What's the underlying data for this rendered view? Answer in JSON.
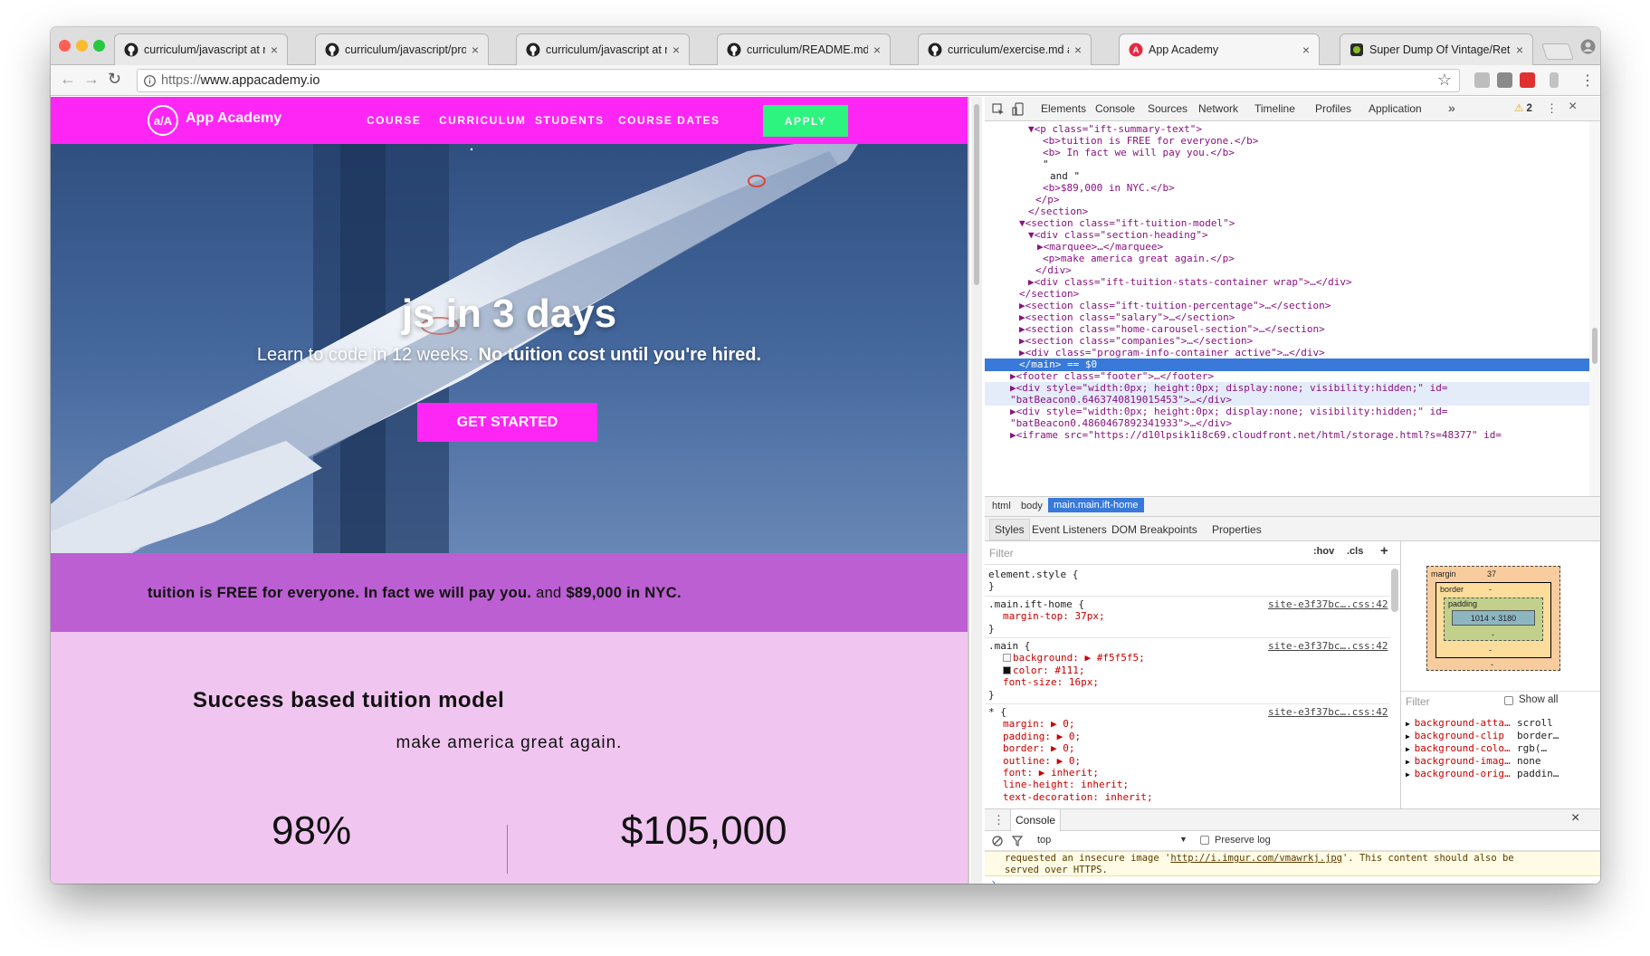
{
  "browser": {
    "tabs": [
      {
        "label": "curriculum/javascript at maste",
        "icon": "github-icon"
      },
      {
        "label": "curriculum/javascript/projects",
        "icon": "github-icon"
      },
      {
        "label": "curriculum/javascript at maste",
        "icon": "github-icon"
      },
      {
        "label": "curriculum/README.md at ma",
        "icon": "github-icon"
      },
      {
        "label": "curriculum/exercise.md at ma",
        "icon": "github-icon"
      },
      {
        "label": "App Academy",
        "icon": "app-academy-icon",
        "active": true
      },
      {
        "label": "Super Dump Of Vintage/Retro",
        "icon": "imgur-icon"
      }
    ],
    "close_glyph": "×",
    "url_scheme": "https://",
    "url_host": "www.appacademy.io",
    "star_glyph": "☆",
    "menu_glyph": "⋮"
  },
  "site": {
    "logo_mark": "a/A",
    "logo_text": "App Academy",
    "nav": [
      "COURSE",
      "CURRICULUM",
      "STUDENTS",
      "COURSE DATES"
    ],
    "apply": "APPLY",
    "hero_title": "js in 3 days",
    "hero_sub_plain": "Learn to code in 12 weeks.",
    "hero_sub_bold": "No tuition cost until you're hired.",
    "cta": "GET STARTED",
    "summary_b1": "tuition is FREE for everyone.",
    "summary_b2": "In fact we will pay you.",
    "summary_mid": "and",
    "summary_b3": "$89,000 in NYC.",
    "tuition_title": "Success based tuition model",
    "tuition_sub": "make america great again.",
    "stat_left": "98%",
    "stat_right": "$105,000",
    "colors": {
      "nav": "#fe26f4",
      "apply": "#2cf47e",
      "summary": "#bb5fd2",
      "tuition": "#f0c5f0"
    }
  },
  "devtools": {
    "tabs": [
      "Elements",
      "Console",
      "Sources",
      "Network",
      "Timeline",
      "Profiles",
      "Application"
    ],
    "more": "»",
    "warn_count": "2",
    "close": "×",
    "elements": [
      {
        "t": "tag",
        "text": "▼<p class=\"ift-summary-text\">"
      },
      {
        "t": "tag",
        "text": "<b>tuition is FREE for everyone.</b>"
      },
      {
        "t": "tag",
        "text": "<b> In fact we will pay you.</b>"
      },
      {
        "t": "text",
        "text": "\""
      },
      {
        "t": "text",
        "text": "and \""
      },
      {
        "t": "tag",
        "text": "<b>$89,000 in NYC.</b>"
      },
      {
        "t": "tag",
        "text": "</p>"
      },
      {
        "t": "tag",
        "text": "</section>"
      },
      {
        "t": "tag",
        "text": "▼<section class=\"ift-tuition-model\">"
      },
      {
        "t": "tag",
        "text": "▼<div class=\"section-heading\">"
      },
      {
        "t": "tag",
        "text": "▶<marquee>…</marquee>"
      },
      {
        "t": "tag",
        "text": "<p>make america great again.</p>"
      },
      {
        "t": "tag",
        "text": "</div>"
      },
      {
        "t": "tag",
        "text": "▶<div class=\"ift-tuition-stats-container wrap\">…</div>"
      },
      {
        "t": "tag",
        "text": "</section>"
      },
      {
        "t": "tag",
        "text": "▶<section class=\"ift-tuition-percentage\">…</section>"
      },
      {
        "t": "tag",
        "text": "▶<section class=\"salary\">…</section>"
      },
      {
        "t": "tag",
        "text": "▶<section class=\"home-carousel-section\">…</section>"
      },
      {
        "t": "tag",
        "text": "▶<section class=\"companies\">…</section>"
      },
      {
        "t": "tag",
        "text": "▶<div class=\"program-info-container active\">…</div>"
      },
      {
        "t": "sel",
        "text": "</main> == $0"
      },
      {
        "t": "tag",
        "text": "▶<footer class=\"footer\">…</footer>"
      },
      {
        "t": "tag",
        "text": "▶<div style=\"width:0px; height:0px; display:none; visibility:hidden;\" id="
      },
      {
        "t": "tag",
        "text": "\"batBeacon0.6463740819015453\">…</div>"
      },
      {
        "t": "tag",
        "text": "▶<div style=\"width:0px; height:0px; display:none; visibility:hidden;\" id="
      },
      {
        "t": "tag",
        "text": "\"batBeacon0.4860467892341933\">…</div>"
      },
      {
        "t": "tag",
        "text": "▶<iframe src=\"https://d10lpsik1i8c69.cloudfront.net/html/storage.html?s=48377\" id="
      }
    ],
    "crumbs": [
      "html",
      "body",
      "main.main.ift-home"
    ],
    "subtabs": [
      "Styles",
      "Event Listeners",
      "DOM Breakpoints",
      "Properties"
    ],
    "filter_placeholder": "Filter",
    "hov": ":hov",
    "cls": ".cls",
    "plus": "+",
    "styles": [
      {
        "text": "element.style {"
      },
      {
        "text": "}"
      },
      {
        "text": ".main.ift-home {",
        "src": "site-e3f37bc….css:42"
      },
      {
        "text": "margin-top: 37px;",
        "prop": true
      },
      {
        "text": "}"
      },
      {
        "text": ".main {",
        "src": "site-e3f37bc….css:42"
      },
      {
        "text": "background: ▶ #f5f5f5;",
        "prop": true,
        "swatch": "#f5f5f5"
      },
      {
        "text": "color: #111;",
        "prop": true,
        "swatch": "#111111"
      },
      {
        "text": "font-size: 16px;",
        "prop": true
      },
      {
        "text": "}"
      },
      {
        "text": "* {",
        "src": "site-e3f37bc….css:42"
      },
      {
        "text": "margin: ▶ 0;",
        "prop": true
      },
      {
        "text": "padding: ▶ 0;",
        "prop": true
      },
      {
        "text": "border: ▶ 0;",
        "prop": true
      },
      {
        "text": "outline: ▶ 0;",
        "prop": true
      },
      {
        "text": "font: ▶ inherit;",
        "prop": true
      },
      {
        "text": "line-height: inherit;",
        "prop": true
      },
      {
        "text": "text-decoration: inherit;",
        "prop": true
      }
    ],
    "boxmodel": {
      "margin": "margin",
      "margin_val": "37",
      "border": "border",
      "padding": "padding",
      "dash": "-",
      "content": "1014 × 3180"
    },
    "computed_filter": "Filter",
    "show_all": "Show all",
    "computed": [
      {
        "p": "background-atta…",
        "v": "scroll"
      },
      {
        "p": "background-clip",
        "v": "border…"
      },
      {
        "p": "background-colo…",
        "v": "rgb(…"
      },
      {
        "p": "background-imag…",
        "v": "none"
      },
      {
        "p": "background-orig…",
        "v": "paddin…"
      }
    ],
    "drawer_tab": "Console",
    "console_context": "top",
    "preserve_log": "Preserve log",
    "console_msg_a": "requested an insecure image '",
    "console_msg_link": "http://i.imgur.com/vmawrkj.jpg",
    "console_msg_b": "'. This content should also be",
    "console_msg_c": "served over HTTPS.",
    "prompt": "›"
  }
}
